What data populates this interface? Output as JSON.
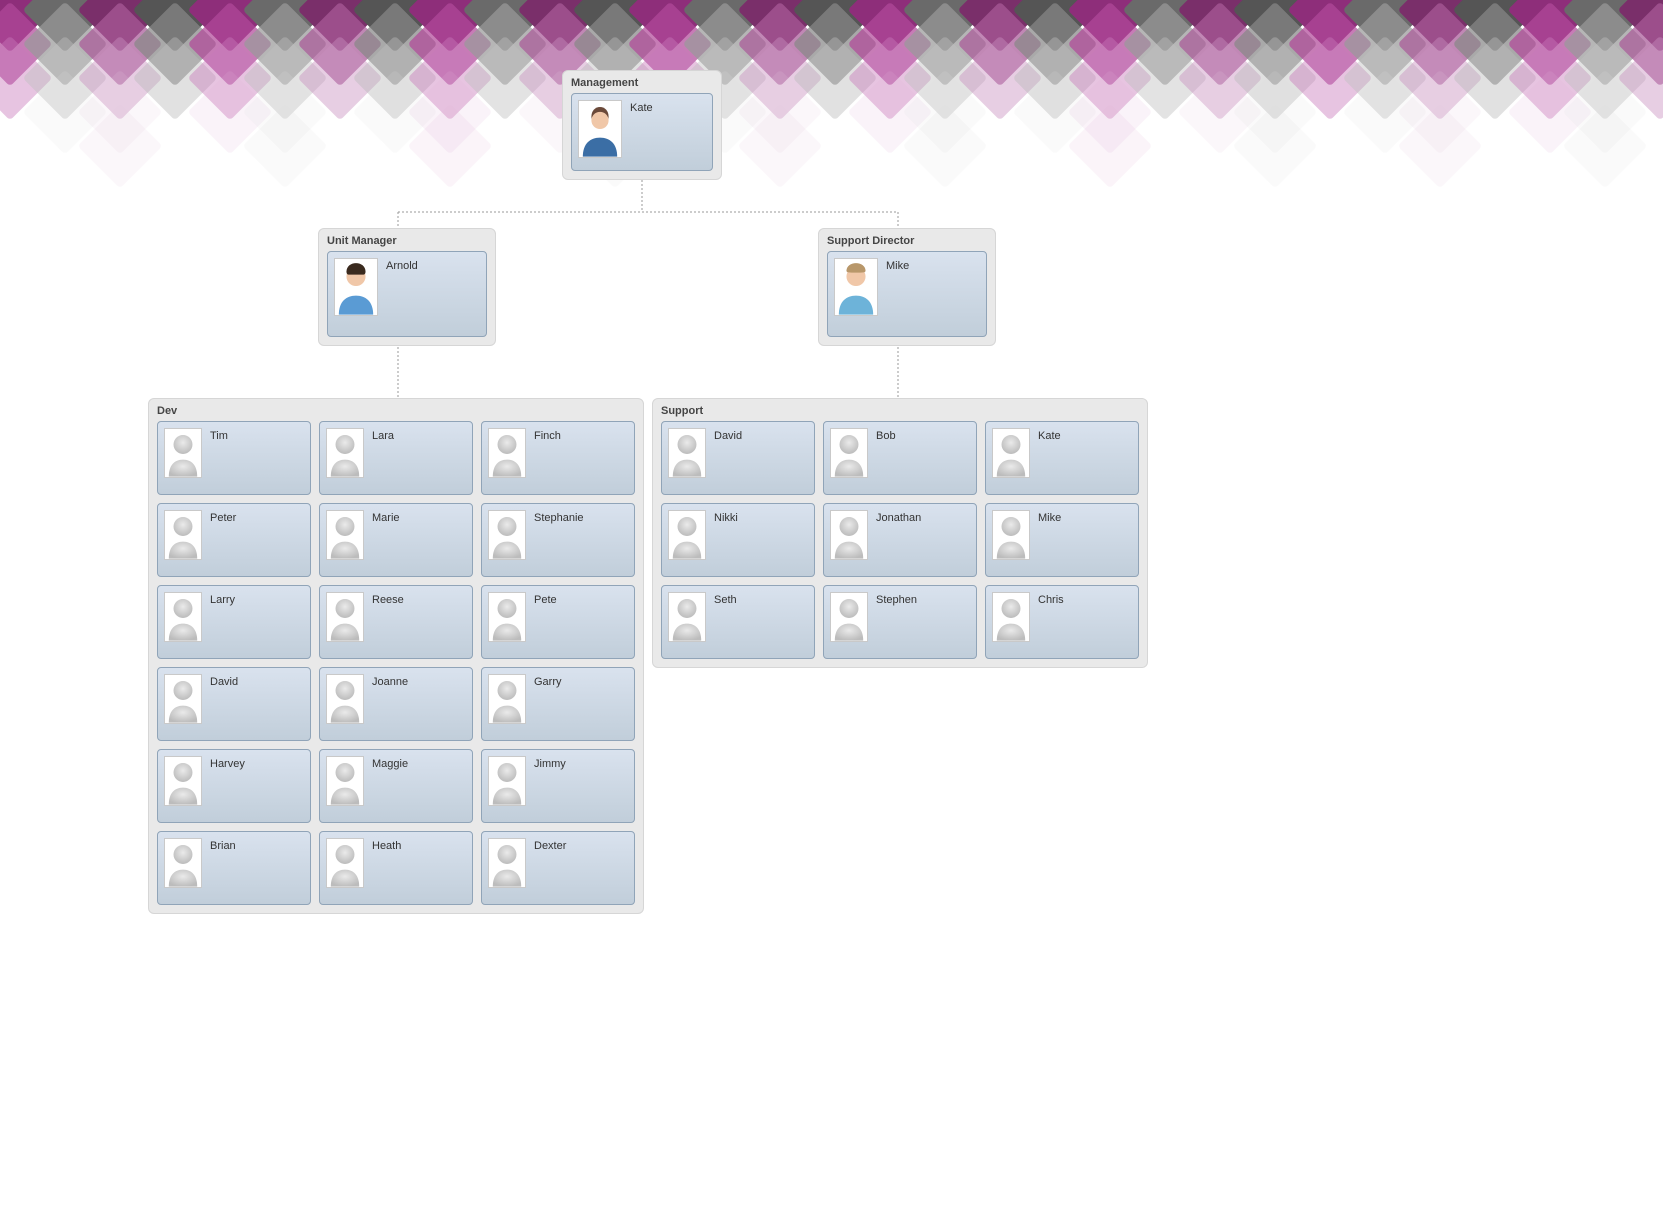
{
  "groups": {
    "management": {
      "title": "Management",
      "member": "Kate"
    },
    "unitManager": {
      "title": "Unit Manager",
      "member": "Arnold"
    },
    "supportDirector": {
      "title": "Support Director",
      "member": "Mike"
    },
    "dev": {
      "title": "Dev",
      "members": [
        "Tim",
        "Lara",
        "Finch",
        "Peter",
        "Marie",
        "Stephanie",
        "Larry",
        "Reese",
        "Pete",
        "David",
        "Joanne",
        "Garry",
        "Harvey",
        "Maggie",
        "Jimmy",
        "Brian",
        "Heath",
        "Dexter"
      ]
    },
    "support": {
      "title": "Support",
      "members": [
        "David",
        "Bob",
        "Kate",
        "Nikki",
        "Jonathan",
        "Mike",
        "Seth",
        "Stephen",
        "Chris"
      ]
    }
  },
  "colors": {
    "cardBorder": "#90a4b8",
    "cardBgTop": "#d9e2ee",
    "cardBgBottom": "#c1ceda",
    "groupBg": "#e9e9e9",
    "connector": "#999999"
  }
}
